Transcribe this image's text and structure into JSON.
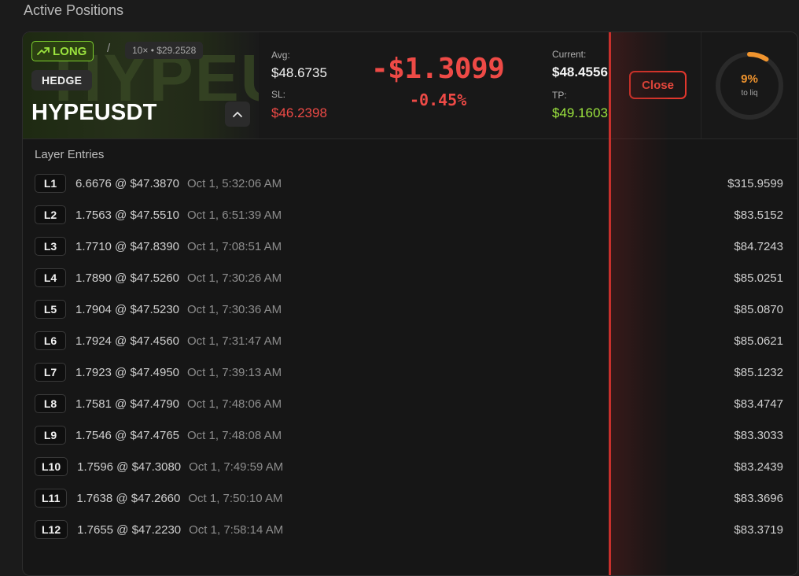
{
  "page": {
    "section_title": "Active Positions"
  },
  "position": {
    "side": "LONG",
    "separator": "/",
    "leverage_info": "10× • $29.2528",
    "hedge_label": "HEDGE",
    "symbol": "HYPEUSDT",
    "watermark": "HYPEUSDT",
    "avg_label": "Avg:",
    "avg_value": "$48.6735",
    "sl_label": "SL:",
    "sl_value": "$46.2398",
    "pnl": "-$1.3099",
    "pnl_pct": "-0.45%",
    "current_label": "Current:",
    "current_value": "$48.4556",
    "tp_label": "TP:",
    "tp_value": "$49.1603",
    "close_label": "Close",
    "liq_pct": "9%",
    "liq_fraction": 0.09,
    "liq_label": "to liq"
  },
  "colors": {
    "long": "#9be33e",
    "loss": "#ee4a46",
    "sl": "#ee4a46",
    "tp": "#9be33e",
    "liq": "#f0942e"
  },
  "icons": {
    "trend": "trend-up-icon",
    "collapse": "chevron-up-icon"
  },
  "layers": {
    "title": "Layer Entries",
    "rows": [
      {
        "id": "L1",
        "qty": "6.6676 @ $47.3870",
        "time": "Oct 1, 5:32:06 AM",
        "amount": "$315.9599"
      },
      {
        "id": "L2",
        "qty": "1.7563 @ $47.5510",
        "time": "Oct 1, 6:51:39 AM",
        "amount": "$83.5152"
      },
      {
        "id": "L3",
        "qty": "1.7710 @ $47.8390",
        "time": "Oct 1, 7:08:51 AM",
        "amount": "$84.7243"
      },
      {
        "id": "L4",
        "qty": "1.7890 @ $47.5260",
        "time": "Oct 1, 7:30:26 AM",
        "amount": "$85.0251"
      },
      {
        "id": "L5",
        "qty": "1.7904 @ $47.5230",
        "time": "Oct 1, 7:30:36 AM",
        "amount": "$85.0870"
      },
      {
        "id": "L6",
        "qty": "1.7924 @ $47.4560",
        "time": "Oct 1, 7:31:47 AM",
        "amount": "$85.0621"
      },
      {
        "id": "L7",
        "qty": "1.7923 @ $47.4950",
        "time": "Oct 1, 7:39:13 AM",
        "amount": "$85.1232"
      },
      {
        "id": "L8",
        "qty": "1.7581 @ $47.4790",
        "time": "Oct 1, 7:48:06 AM",
        "amount": "$83.4747"
      },
      {
        "id": "L9",
        "qty": "1.7546 @ $47.4765",
        "time": "Oct 1, 7:48:08 AM",
        "amount": "$83.3033"
      },
      {
        "id": "L10",
        "qty": "1.7596 @ $47.3080",
        "time": "Oct 1, 7:49:59 AM",
        "amount": "$83.2439"
      },
      {
        "id": "L11",
        "qty": "1.7638 @ $47.2660",
        "time": "Oct 1, 7:50:10 AM",
        "amount": "$83.3696"
      },
      {
        "id": "L12",
        "qty": "1.7655 @ $47.2230",
        "time": "Oct 1, 7:58:14 AM",
        "amount": "$83.3719"
      }
    ]
  }
}
